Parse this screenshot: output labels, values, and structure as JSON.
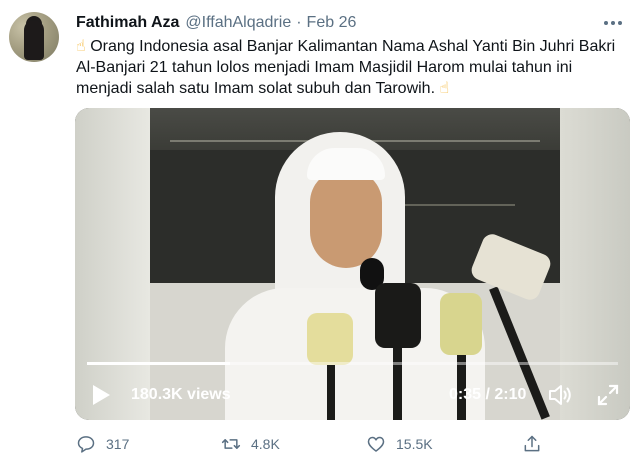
{
  "tweet": {
    "author_name": "Fathimah Aza",
    "author_handle": "@IffahAlqadrie",
    "separator": "·",
    "date": "Feb 26",
    "emoji_start": "☝",
    "emoji_end": "☝",
    "text": "Orang Indonesia asal Banjar Kalimantan Nama Ashal Yanti Bin Juhri Bakri Al-Banjari 21 tahun lolos menjadi Imam Masjidil Harom mulai tahun ini menjadi salah satu Imam solat subuh dan Tarowih."
  },
  "video": {
    "views": "180.3K views",
    "time": "0:35 / 2:10",
    "progress": 0.27
  },
  "actions": {
    "replies": "317",
    "retweets": "4.8K",
    "likes": "15.5K"
  },
  "icons": {
    "more": "more-horizontal-icon",
    "play": "play-icon",
    "volume": "volume-icon",
    "fullscreen": "fullscreen-icon",
    "reply": "reply-icon",
    "retweet": "retweet-icon",
    "like": "heart-icon",
    "share": "share-icon"
  },
  "colors": {
    "text": "#0f1419",
    "secondary": "#5b7083",
    "emoji": "#f4b83a"
  }
}
